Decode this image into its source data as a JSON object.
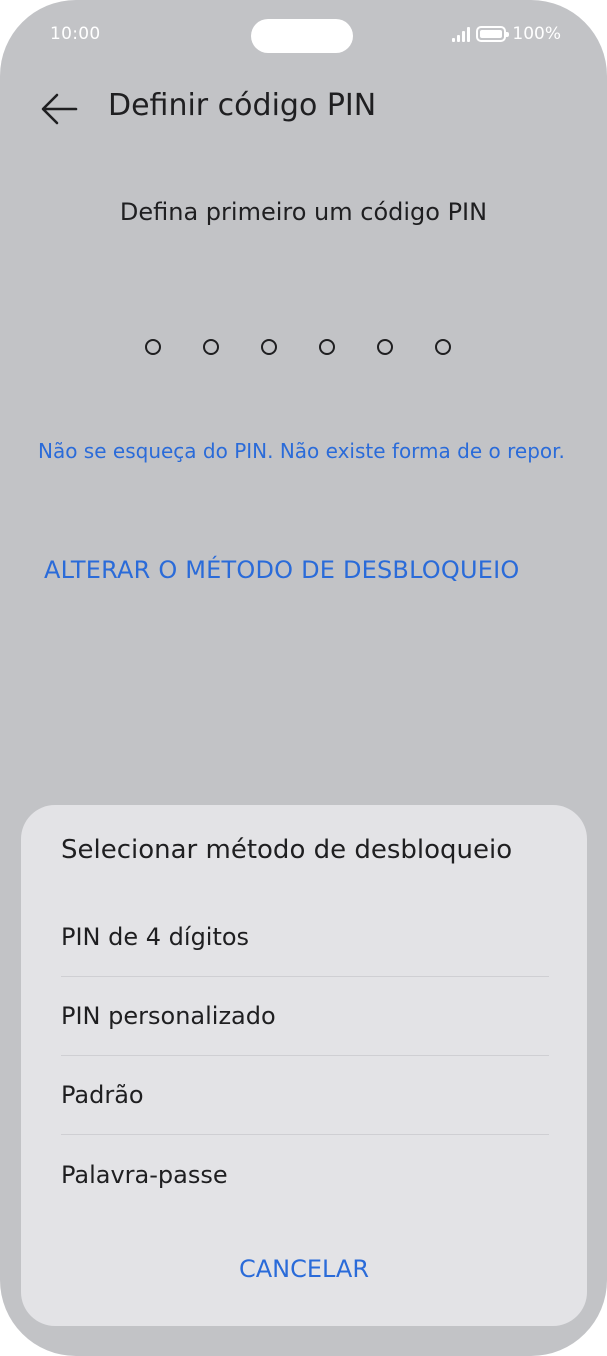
{
  "status_bar": {
    "time": "10:00",
    "battery": "100%",
    "icons": [
      "signal-icon",
      "battery-icon"
    ]
  },
  "app_bar": {
    "back_icon": "back-arrow-icon",
    "title": "Definir código PIN"
  },
  "pin_entry": {
    "prompt": "Defina primeiro um código PIN",
    "digits_count": 6
  },
  "warning": "Não se esqueça do PIN. Não existe forma de o repor.",
  "change_method_label": "ALTERAR O MÉTODO DE DESBLOQUEIO",
  "sheet": {
    "title": "Selecionar método de desbloqueio",
    "options": [
      {
        "label": "PIN de 4 dígitos"
      },
      {
        "label": "PIN personalizado"
      },
      {
        "label": "Padrão"
      },
      {
        "label": "Palavra-passe"
      }
    ],
    "cancel_label": "CANCELAR"
  },
  "colors": {
    "accent": "#2a6bd9",
    "background": "#c2c3c6",
    "sheet": "#e3e3e6",
    "text": "#1f1f21"
  }
}
